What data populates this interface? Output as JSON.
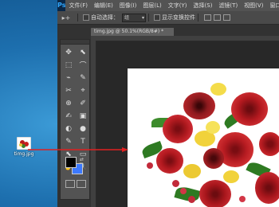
{
  "photoshop": {
    "logo": "Ps",
    "menu": [
      "文件(F)",
      "编辑(E)",
      "图像(I)",
      "图层(L)",
      "文字(Y)",
      "选择(S)",
      "滤镜(T)",
      "视图(V)",
      "窗口(W)"
    ],
    "options": {
      "move_glyph": "▸+",
      "auto_select_label": "自动选择：",
      "auto_select_value": "组",
      "transform_label": "显示变换控件"
    },
    "document_tab": "timg.jpg @ 50.1%(RGB/8#) *",
    "tool_glyphs": [
      "✥",
      "⬉",
      "⬚",
      "⌒",
      "⌁",
      "✎",
      "✂",
      "⌖",
      "⊕",
      "✐",
      "✍",
      "▣",
      "◐",
      "●",
      "✎",
      "T",
      "⬉",
      "▭",
      "✋",
      "🔍"
    ]
  },
  "desktop": {
    "icon_label": "timg.jpg"
  },
  "colors": {
    "foreground": "#000000",
    "background": "#3c79ff",
    "arrow": "#e02020"
  }
}
